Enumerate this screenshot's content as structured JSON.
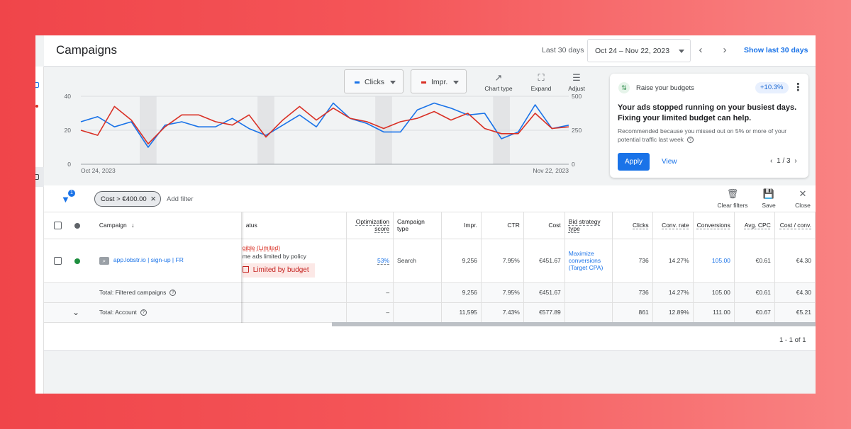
{
  "header": {
    "title": "Campaigns",
    "range_label": "Last 30 days",
    "date_range": "Oct 24 – Nov 22, 2023",
    "show_last": "Show last 30 days"
  },
  "chart_controls": {
    "metric1": "Clicks",
    "metric2": "Impr.",
    "metric1_color": "#1a73e8",
    "metric2_color": "#d93025",
    "chart_type": "Chart type",
    "expand": "Expand",
    "adjust": "Adjust"
  },
  "chart_data": {
    "type": "line",
    "x_start": "Oct 24, 2023",
    "x_end": "Nov 22, 2023",
    "left_ticks": [
      "40",
      "20",
      "0"
    ],
    "right_ticks": [
      "500",
      "250",
      "0"
    ],
    "ylim_left": [
      0,
      40
    ],
    "ylim_right": [
      0,
      500
    ],
    "grid": true,
    "series": [
      {
        "name": "Clicks",
        "axis": "left",
        "color": "#1a73e8",
        "values": [
          25,
          28,
          22,
          25,
          10,
          23,
          25,
          22,
          22,
          27,
          21,
          17,
          23,
          29,
          22,
          36,
          27,
          24,
          19,
          19,
          32,
          36,
          33,
          29,
          30,
          15,
          19,
          35,
          21,
          23
        ]
      },
      {
        "name": "Impr.",
        "axis": "right",
        "color": "#d93025",
        "values": [
          250,
          213,
          425,
          325,
          150,
          275,
          363,
          363,
          313,
          288,
          363,
          200,
          325,
          425,
          325,
          413,
          338,
          313,
          263,
          313,
          338,
          388,
          325,
          375,
          263,
          225,
          225,
          375,
          263,
          275
        ]
      }
    ]
  },
  "recommendation": {
    "title": "Raise your budgets",
    "badge": "+10.3%",
    "headline": "Your ads stopped running on your busiest days. Fixing your limited budget can help.",
    "reason": "Recommended because you missed out on 5% or more of your potential traffic last week",
    "apply": "Apply",
    "view": "View",
    "pager": "1 / 3"
  },
  "filters": {
    "badge": "1",
    "chip": "Cost > €400.00",
    "add_filter": "Add filter",
    "clear": "Clear filters",
    "save": "Save",
    "close": "Close"
  },
  "table": {
    "headers": {
      "campaign": "Campaign",
      "status": "atus",
      "opt": "Optimization score",
      "type": "Campaign type",
      "impr": "Impr.",
      "ctr": "CTR",
      "cost": "Cost",
      "bid": "Bid strategy type",
      "clicks": "Clicks",
      "conv_rate": "Conv. rate",
      "conversions": "Conversions",
      "avg_cpc": "Avg. CPC",
      "cost_conv": "Cost / conv."
    },
    "row": {
      "campaign": "app.lobstr.io | sign-up | FR",
      "status_1": "gible (Limited)",
      "status_2": "me ads limited by policy",
      "status_badge": "Limited by budget",
      "opt": "53%",
      "type": "Search",
      "impr": "9,256",
      "ctr": "7.95%",
      "cost": "€451.67",
      "bid": [
        "Maximize",
        "conversions",
        "(Target CPA)"
      ],
      "clicks": "736",
      "conv_rate": "14.27%",
      "conversions": "105.00",
      "avg_cpc": "€0.61",
      "cost_conv": "€4.30"
    },
    "total_filtered": {
      "label": "Total: Filtered campaigns",
      "opt": "–",
      "impr": "9,256",
      "ctr": "7.95%",
      "cost": "€451.67",
      "clicks": "736",
      "conv_rate": "14.27%",
      "conversions": "105.00",
      "avg_cpc": "€0.61",
      "cost_conv": "€4.30"
    },
    "total_account": {
      "label": "Total: Account",
      "opt": "–",
      "impr": "11,595",
      "ctr": "7.43%",
      "cost": "€577.89",
      "clicks": "861",
      "conv_rate": "12.89%",
      "conversions": "111.00",
      "avg_cpc": "€0.67",
      "cost_conv": "€5.21"
    }
  },
  "pagination": "1 - 1 of 1"
}
